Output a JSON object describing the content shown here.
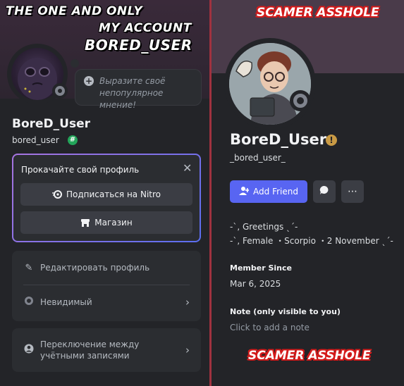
{
  "left_profile": {
    "captions": [
      "THE ONE AND ONLY",
      "MY ACCOUNT",
      "BORED_USER"
    ],
    "status_bubble_placeholder": "Выразите своё непопулярное мнение!",
    "display_name": "BoreD_User",
    "username": "bored_user",
    "badge_symbol": "#",
    "nitro_card": {
      "title": "Прокачайте свой профиль",
      "subscribe_label": "Подписаться на Nitro",
      "shop_label": "Магазин"
    },
    "menu": {
      "edit_profile": "Редактировать профиль",
      "status": "Невидимый",
      "switch_accounts": "Переключение между учётными записями"
    }
  },
  "right_profile": {
    "captions": [
      "SCAMER ASSHOLE",
      "SCAMER ASSHOLE"
    ],
    "display_name": "BoreD_User",
    "username": "_bored_user_",
    "add_friend_label": "Add Friend",
    "bio": [
      "-ˋ, Greetings ˎ´-",
      "-ˋ, Female ・Scorpio ・2 November ˎ´-"
    ],
    "member_since_label": "Member Since",
    "member_since_value": "Mar 6, 2025",
    "note_label": "Note (only visible to you)",
    "note_placeholder": "Click to add a note"
  },
  "icons": [
    "plus-icon",
    "nitro-icon",
    "shop-icon",
    "close-icon",
    "pencil-icon",
    "status-circle-icon",
    "account-icon",
    "chevron-right-icon",
    "add-user-icon",
    "message-icon",
    "more-icon",
    "warning-icon"
  ],
  "colors": {
    "accent_blurple": "#5865f2",
    "online_green": "#23a55a",
    "caption_red": "#d41a1a",
    "divider_red": "#a0323f"
  }
}
